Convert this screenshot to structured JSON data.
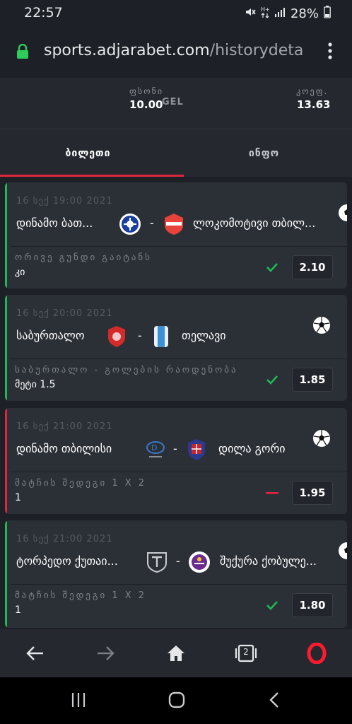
{
  "status_bar": {
    "time": "22:57",
    "battery": "28%",
    "icons": [
      "mute-icon",
      "data-icon",
      "signal-icon",
      "battery-icon"
    ]
  },
  "browser": {
    "url_main": "sports.adjarabet.com",
    "url_path": "/historydeta",
    "lock_icon": "lock-icon",
    "menu_icon": "more-vert-icon"
  },
  "summary": {
    "stake_label": "ფსონი",
    "stake_value": "10.00",
    "currency": "GEL",
    "odds_label": "კოეფ.",
    "odds_value": "13.63"
  },
  "tabs": [
    {
      "label": "ბილეთი",
      "active": true
    },
    {
      "label": "ინფო",
      "active": false
    }
  ],
  "bets": [
    {
      "date": "16 სექ 19:00 2021",
      "home": "დინამო ბათ...",
      "away": "ლოკომოტივი თბილ...",
      "separator": "-",
      "market": "ორივე გუნდი გაიტანს",
      "pick": "კი",
      "result": "won",
      "odd": "2.10"
    },
    {
      "date": "16 სექ 20:00 2021",
      "home": "საბურთალო",
      "away": "თელავი",
      "separator": "-",
      "market": "საბურთალო - გოლების რაოდენობა",
      "pick": "მეტი 1.5",
      "result": "won",
      "odd": "1.85"
    },
    {
      "date": "16 სექ 21:00 2021",
      "home": "დინამო თბილისი",
      "away": "დილა გორი",
      "separator": "-",
      "market": "მატჩის შედეგი 1 X 2",
      "pick": "1",
      "result": "lost",
      "odd": "1.95"
    },
    {
      "date": "16 სექ 21:00 2021",
      "home": "ტორპედო ქუთაი...",
      "away": "შუქურა ქობულე...",
      "separator": "-",
      "market": "მატჩის შედეგი 1 X 2",
      "pick": "1",
      "result": "won",
      "odd": "1.80"
    }
  ],
  "colors": {
    "won": "#1db954",
    "lost": "#e0263d",
    "accent": "#e0263d",
    "background": "#1d2127",
    "card": "#2b3037"
  },
  "browser_nav": {
    "tab_count": "2",
    "icons": [
      "back-icon",
      "forward-icon",
      "home-icon",
      "tabs-icon",
      "opera-icon"
    ]
  },
  "system_nav": {
    "icons": [
      "recents-icon",
      "home-circle-icon",
      "back-chevron-icon"
    ]
  }
}
